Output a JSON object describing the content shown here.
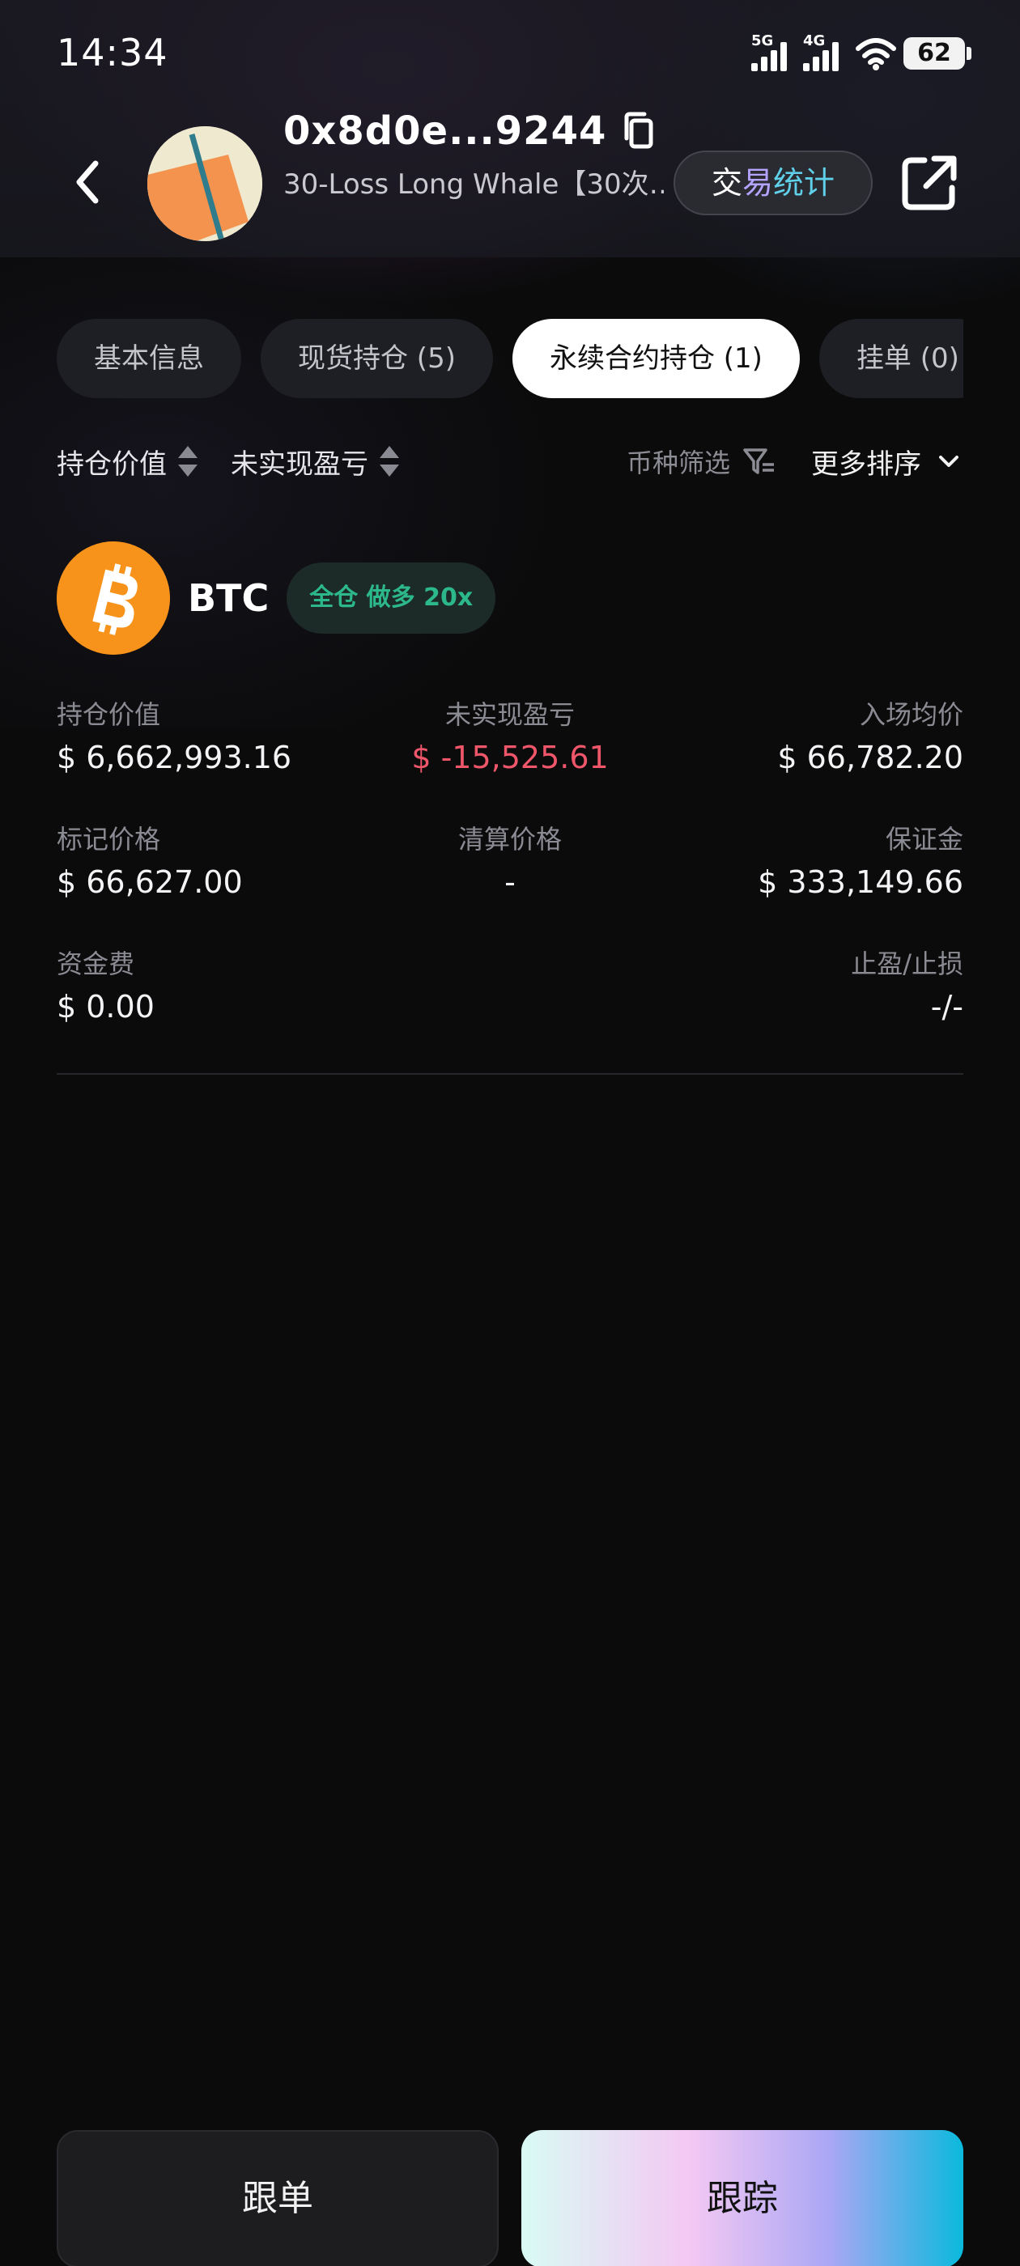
{
  "status_bar": {
    "time": "14:34",
    "signal_1_tag": "5G",
    "signal_2_tag": "4G",
    "battery": "62"
  },
  "header": {
    "address": "0x8d0e...9244",
    "wallet_label": "30-Loss Long Whale【30次…",
    "stats_button": {
      "part1": "交",
      "part2": "易",
      "part3": "统计"
    },
    "icons": [
      "back-icon",
      "copy-icon",
      "share-external-icon"
    ]
  },
  "tabs": [
    {
      "label": "基本信息"
    },
    {
      "label": "现货持仓 (5)"
    },
    {
      "label": "永续合约持仓 (1)",
      "active": true
    },
    {
      "label": "挂单 (0)"
    }
  ],
  "sort_row": {
    "sort1": "持仓价值",
    "sort2": "未实现盈亏",
    "filter": "币种筛选",
    "more_sort": "更多排序"
  },
  "position": {
    "coin": "BTC",
    "badge": "全仓 做多 20x",
    "fields": {
      "position_value_label": "持仓价值",
      "position_value": "$ 6,662,993.16",
      "unrealized_pnl_label": "未实现盈亏",
      "unrealized_pnl": "$ -15,525.61",
      "entry_price_label": "入场均价",
      "entry_price": "$ 66,782.20",
      "mark_price_label": "标记价格",
      "mark_price": "$ 66,627.00",
      "liq_price_label": "清算价格",
      "liq_price": "-",
      "margin_label": "保证金",
      "margin": "$ 333,149.66",
      "funding_label": "资金费",
      "funding": "$ 0.00",
      "tpsl_label": "止盈/止损",
      "tpsl": "-/-"
    }
  },
  "bottom": {
    "copy_trade": "跟单",
    "track": "跟踪"
  },
  "colors": {
    "background": "#0b0b0c",
    "negative": "#f0566a",
    "long_badge": "#2cb88a",
    "btc_orange": "#f7931a"
  }
}
